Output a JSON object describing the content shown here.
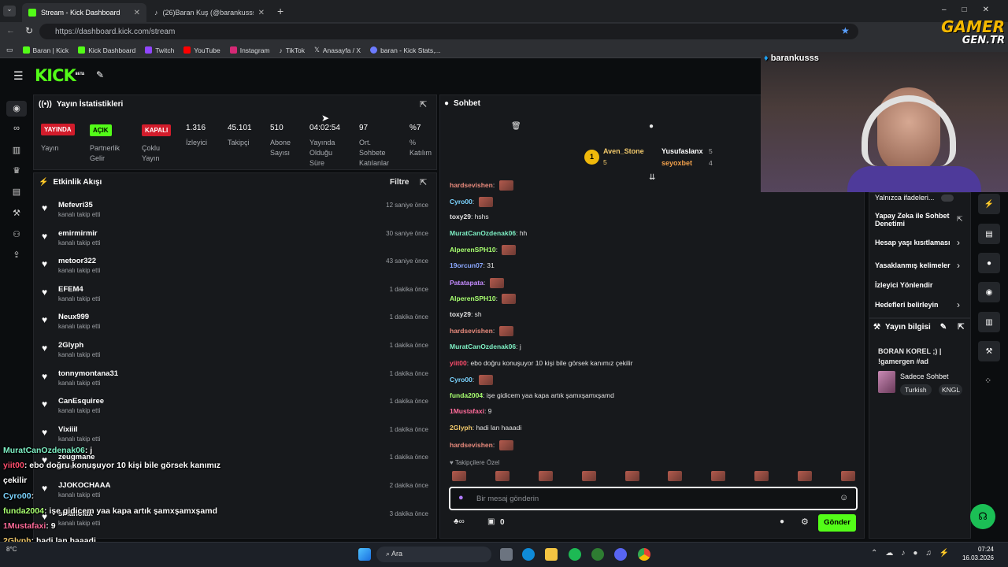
{
  "browser": {
    "tabs": [
      {
        "label": "Stream - Kick Dashboard",
        "icon": "kick-icon"
      },
      {
        "label": "(26)Baran Kuş (@barankusss) | Tik",
        "icon": "tiktok-icon"
      }
    ],
    "url": "https://dashboard.kick.com/stream",
    "bookmarks": [
      "Baran | Kick",
      "Kick Dashboard",
      "Twitch",
      "YouTube",
      "Instagram",
      "TikTok",
      "Anasayfa / X",
      "baran - Kick Stats,..."
    ]
  },
  "watermark": {
    "line1": "GAMER",
    "line2": "GEN.TR"
  },
  "webcam": {
    "handle": "barankusss"
  },
  "kick": {
    "logo": "KICK",
    "beta": "BETA"
  },
  "stats": {
    "title": "Yayın İstatistikleri",
    "items": [
      {
        "badge": "YAYINDA",
        "label": "Yayın"
      },
      {
        "badge": "AÇIK",
        "label": "Partnerlik Gelir Programı"
      },
      {
        "badge": "KAPALI",
        "label": "Çoklu Yayın"
      },
      {
        "value": "1.316",
        "label": "İzleyici"
      },
      {
        "value": "45.101",
        "label": "Takipçi"
      },
      {
        "value": "510",
        "label": "Abone Sayısı"
      },
      {
        "value": "04:02:54",
        "label": "Yayında Olduğu Süre"
      },
      {
        "value": "97",
        "label": "Ort. Sohbete Katılanlar"
      },
      {
        "value": "%7",
        "label": "% Katılım"
      }
    ]
  },
  "activity": {
    "title": "Etkinlik Akışı",
    "filter": "Filtre",
    "rows": [
      {
        "name": "Mefevri35",
        "desc": "kanalı takip etti",
        "time": "12 saniye önce"
      },
      {
        "name": "emirmirmir",
        "desc": "kanalı takip etti",
        "time": "30 saniye önce"
      },
      {
        "name": "metoor322",
        "desc": "kanalı takip etti",
        "time": "43 saniye önce"
      },
      {
        "name": "EFEM4",
        "desc": "kanalı takip etti",
        "time": "1 dakika önce"
      },
      {
        "name": "Neux999",
        "desc": "kanalı takip etti",
        "time": "1 dakika önce"
      },
      {
        "name": "2Glyph",
        "desc": "kanalı takip etti",
        "time": "1 dakika önce"
      },
      {
        "name": "tonnymontana31",
        "desc": "kanalı takip etti",
        "time": "1 dakika önce"
      },
      {
        "name": "CanEsquiree",
        "desc": "kanalı takip etti",
        "time": "1 dakika önce"
      },
      {
        "name": "Vixiiil",
        "desc": "kanalı takip etti",
        "time": "1 dakika önce"
      },
      {
        "name": "zeugmane",
        "desc": "kanalı takip etti",
        "time": "1 dakika önce"
      },
      {
        "name": "JJOKOCHAAA",
        "desc": "kanalı takip etti",
        "time": "2 dakika önce"
      },
      {
        "name": "sinanolak",
        "desc": "kanalı takip etti",
        "time": "3 dakika önce"
      }
    ]
  },
  "chat": {
    "title": "Sohbet",
    "leaders": [
      {
        "rank": "1",
        "name": "Aven_Stone",
        "count": "5"
      },
      {
        "name": "Yusufaslanx",
        "count": "5"
      },
      {
        "name": "seyoxbet",
        "count": "4"
      }
    ],
    "messages": [
      {
        "user": "hardsevishen",
        "text": "",
        "color": "#e88a7c",
        "emote": true
      },
      {
        "user": "Cyro00",
        "text": "",
        "color": "#7bd4ff",
        "emote": true
      },
      {
        "user": "toxy29",
        "text": "hshs",
        "color": "#e3e3e3",
        "emote": false
      },
      {
        "user": "MuratCanOzdenak06",
        "text": "hh",
        "color": "#7ef0c4",
        "emote": false
      },
      {
        "user": "AlperenSPH10",
        "text": "",
        "color": "#a8ff70",
        "emote": true
      },
      {
        "user": "19orcun07",
        "text": "31",
        "color": "#8ba8ff",
        "emote": false
      },
      {
        "user": "Patatapata",
        "text": "",
        "color": "#c58bff",
        "emote": true
      },
      {
        "user": "AlperenSPH10",
        "text": "",
        "color": "#a8ff70",
        "emote": true
      },
      {
        "user": "toxy29",
        "text": "sh",
        "color": "#e3e3e3",
        "emote": false
      },
      {
        "user": "hardsevishen",
        "text": "",
        "color": "#e88a7c",
        "emote": true
      },
      {
        "user": "MuratCanOzdenak06",
        "text": "j",
        "color": "#7ef0c4",
        "emote": false
      },
      {
        "user": "yiit00",
        "text": "ebo doğru konuşuyor 10 kişi bile görsek kanımız çekilir",
        "color": "#ff4d6d",
        "emote": false
      },
      {
        "user": "Cyro00",
        "text": "",
        "color": "#7bd4ff",
        "emote": true
      },
      {
        "user": "funda2004",
        "text": "işe gidicem yaa kapa artık şamxşamxşamd",
        "color": "#a8ff70",
        "emote": false
      },
      {
        "user": "1Mustafaxi",
        "text": "9",
        "color": "#ff6b9a",
        "emote": false
      },
      {
        "user": "2Glyph",
        "text": "hadi lan haaadi",
        "color": "#f0c86b",
        "emote": false
      },
      {
        "user": "hardsevishen",
        "text": "",
        "color": "#e88a7c",
        "emote": true
      }
    ],
    "followers_only": "Takipçilere Özel",
    "input_placeholder": "Bir mesaj gönderin",
    "count": "0",
    "send": "Gönder"
  },
  "right_panel": {
    "items": [
      {
        "label": "Yalnızca ifadeleri..."
      },
      {
        "label": "Yapay Zeka ile Sohbet Denetimi"
      },
      {
        "label": "Hesap yaşı kısıtlaması"
      },
      {
        "label": "Yasaklanmış kelimeler"
      },
      {
        "label": "İzleyici Yönlendir"
      },
      {
        "label": "Hedefleri belirleyin"
      }
    ],
    "info_title": "Yayın bilgisi",
    "stream_title": "BORAN KOREL ;) | !gamergen #ad",
    "category": "Sadece Sohbet",
    "tags": [
      "Turkish",
      "KNGL"
    ]
  },
  "overlay": [
    {
      "user": "MuratCanOzdenak06",
      "text": ": j",
      "color": "#7ef0c4"
    },
    {
      "user": "yiit00",
      "text": ": ebo doğru konuşuyor 10 kişi bile görsek kanımız",
      "color": "#ff4d6d"
    },
    {
      "user": "",
      "text": "çekilir",
      "color": "#ffffff"
    },
    {
      "user": "Cyro00",
      "text": ":",
      "color": "#7bd4ff"
    },
    {
      "user": "funda2004",
      "text": ": işe gidicem yaa kapa artık şamxşamxşamd",
      "color": "#a8ff70"
    },
    {
      "user": "1Mustafaxi",
      "text": ": 9",
      "color": "#ff6b9a"
    },
    {
      "user": "2Glyph",
      "text": ": hadi lan haaadi",
      "color": "#f0c86b"
    },
    {
      "user": "hardsevishen",
      "text": ":",
      "color": "#e88a7c"
    }
  ],
  "taskbar": {
    "search": "Ara",
    "weather": "8°C",
    "time": "07:24",
    "date": "16.03.2026"
  }
}
